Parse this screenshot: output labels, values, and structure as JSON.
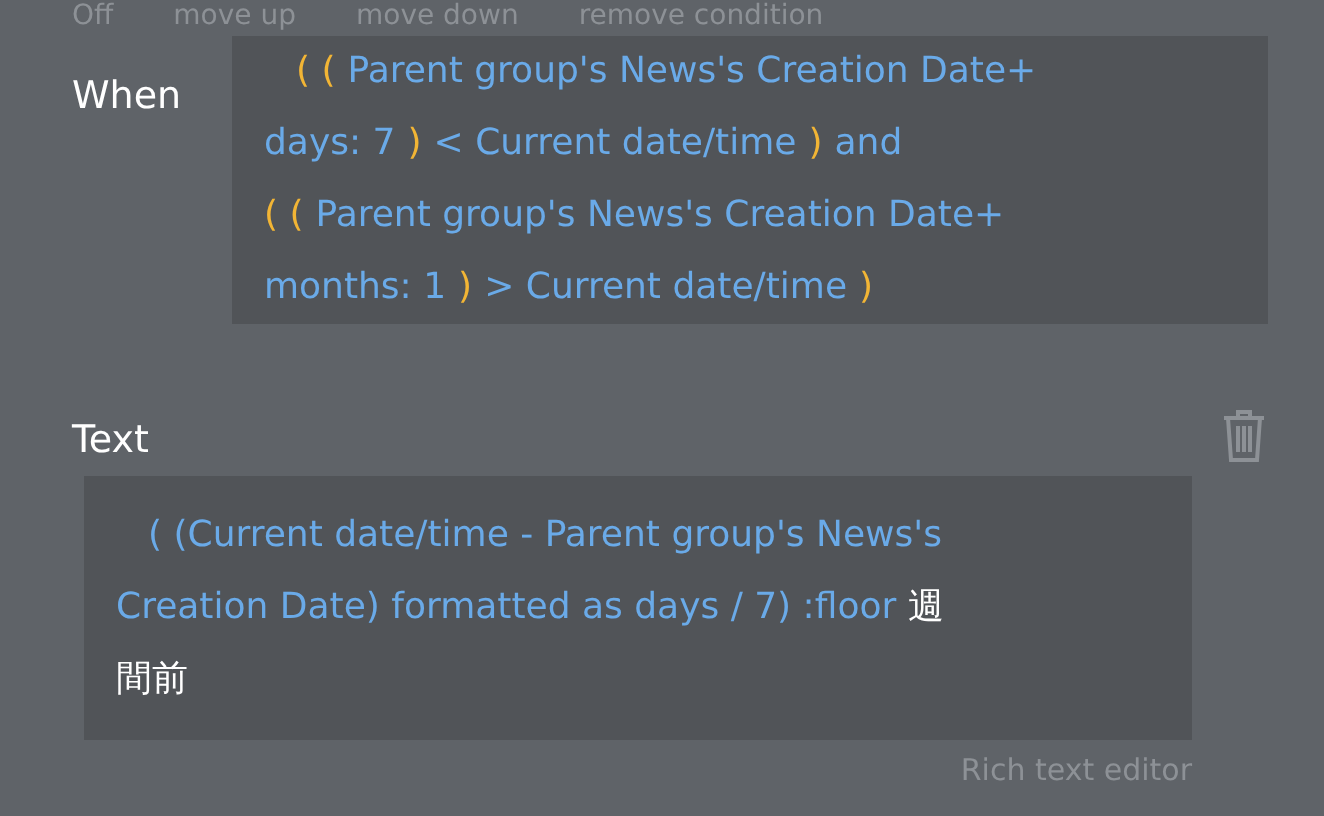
{
  "top_actions": [
    "Off",
    "move up",
    "move down",
    "remove condition"
  ],
  "condition": {
    "label": "When",
    "lines": [
      [
        {
          "kind": "paren",
          "text": "( ("
        },
        {
          "kind": "expr",
          "text": "Parent group's News's Creation Date+"
        }
      ],
      [
        {
          "kind": "expr",
          "text": "days: 7"
        },
        {
          "kind": "paren",
          "text": ")"
        },
        {
          "kind": "expr",
          "text": "< Current date/time"
        },
        {
          "kind": "paren",
          "text": ")"
        },
        {
          "kind": "expr",
          "text": "and"
        }
      ],
      [
        {
          "kind": "paren",
          "text": "( ("
        },
        {
          "kind": "expr",
          "text": "Parent group's News's Creation Date+"
        }
      ],
      [
        {
          "kind": "expr",
          "text": "months: 1"
        },
        {
          "kind": "paren",
          "text": ")"
        },
        {
          "kind": "expr",
          "text": "> Current date/time"
        },
        {
          "kind": "paren",
          "text": ")"
        }
      ]
    ]
  },
  "text_property": {
    "label": "Text",
    "lines": [
      [
        {
          "kind": "expr",
          "text": "( (Current date/time - Parent group's News's"
        }
      ],
      [
        {
          "kind": "expr",
          "text": "Creation Date) formatted as days / 7) :floor"
        },
        {
          "kind": "plain",
          "text": "週"
        }
      ],
      [
        {
          "kind": "plain",
          "text": "間前"
        }
      ]
    ]
  },
  "editor_link": "Rich text editor"
}
